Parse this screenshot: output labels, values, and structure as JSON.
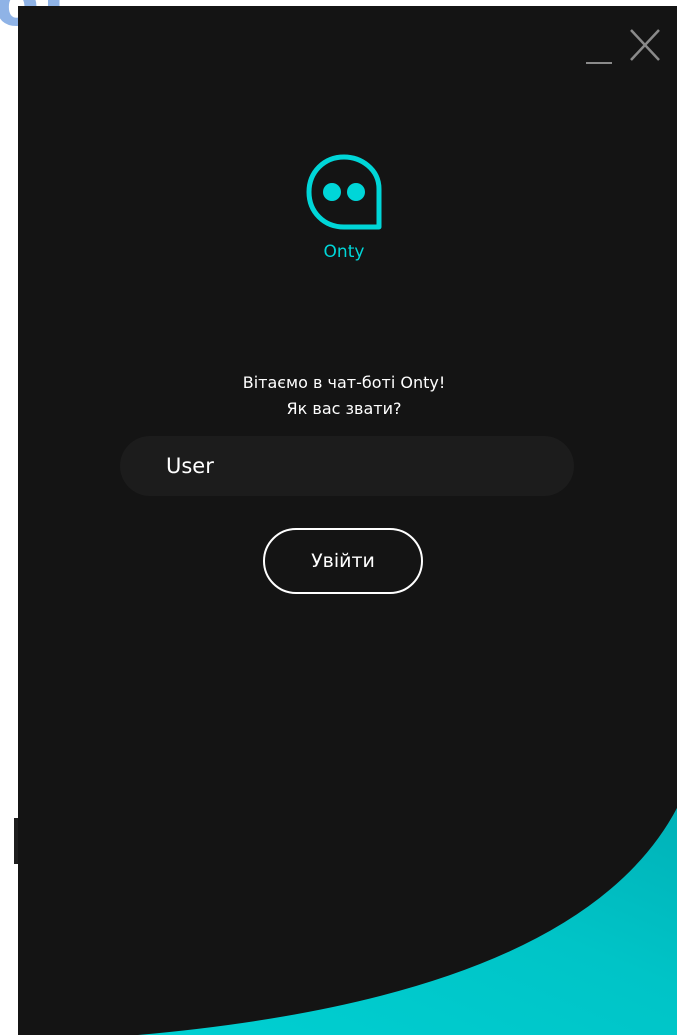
{
  "background": {
    "fragment_text": "ot"
  },
  "window": {
    "controls": {
      "minimize_icon": "minimize-icon",
      "close_icon": "close-icon"
    }
  },
  "logo": {
    "icon": "chat-bot-face-icon",
    "name": "Onty"
  },
  "welcome": {
    "line1": "Вітаємо в чат-боті Onty!",
    "line2": "Як вас звати?"
  },
  "name_input": {
    "value": "User"
  },
  "login_button": {
    "label": "Увійти"
  },
  "colors": {
    "background": "#141414",
    "accent": "#00d6d8",
    "input_background": "#1c1c1c",
    "text": "#ffffff"
  }
}
